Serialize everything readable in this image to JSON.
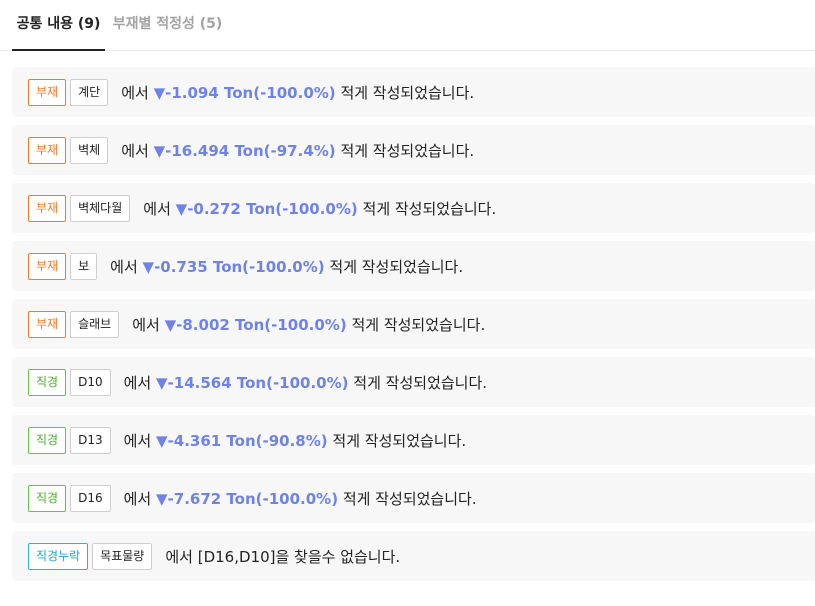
{
  "tabs": [
    {
      "label": "공통 내용 (9)",
      "active": true
    },
    {
      "label": "부재별 적정성 (5)",
      "active": false
    }
  ],
  "colors": {
    "orange": "#f07a2a",
    "green": "#4caa2c",
    "cyan": "#1fa4c8",
    "delta_blue": "#6f83e6"
  },
  "rows": [
    {
      "category": "부재",
      "item": "계단",
      "pre": "에서",
      "delta": "▼-1.094 Ton(-100.0%)",
      "post": "적게 작성되었습니다."
    },
    {
      "category": "부재",
      "item": "벽체",
      "pre": "에서",
      "delta": "▼-16.494 Ton(-97.4%)",
      "post": "적게 작성되었습니다."
    },
    {
      "category": "부재",
      "item": "벽체다월",
      "pre": "에서",
      "delta": "▼-0.272 Ton(-100.0%)",
      "post": "적게 작성되었습니다."
    },
    {
      "category": "부재",
      "item": "보",
      "pre": "에서",
      "delta": "▼-0.735 Ton(-100.0%)",
      "post": "적게 작성되었습니다."
    },
    {
      "category": "부재",
      "item": "슬래브",
      "pre": "에서",
      "delta": "▼-8.002 Ton(-100.0%)",
      "post": "적게 작성되었습니다."
    },
    {
      "category": "직경",
      "item": "D10",
      "pre": "에서",
      "delta": "▼-14.564 Ton(-100.0%)",
      "post": "적게 작성되었습니다."
    },
    {
      "category": "직경",
      "item": "D13",
      "pre": "에서",
      "delta": "▼-4.361 Ton(-90.8%)",
      "post": "적게 작성되었습니다."
    },
    {
      "category": "직경",
      "item": "D16",
      "pre": "에서",
      "delta": "▼-7.672 Ton(-100.0%)",
      "post": "적게 작성되었습니다."
    },
    {
      "category": "직경누락",
      "item": "목표물량",
      "pre": "에서 [D16,D10]을 찾을수 없습니다.",
      "delta": "",
      "post": ""
    }
  ]
}
